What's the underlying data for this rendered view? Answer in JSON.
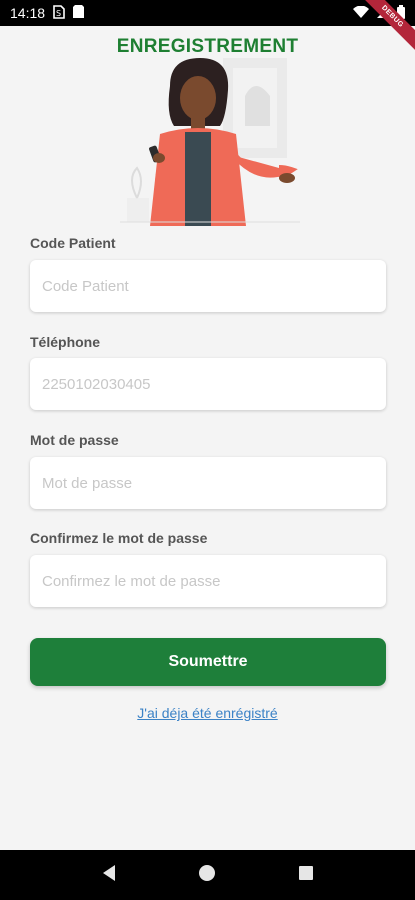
{
  "status_bar": {
    "time": "14:18"
  },
  "debug_banner": "DEBUG",
  "page": {
    "title": "ENREGISTREMENT"
  },
  "form": {
    "patient_code": {
      "label": "Code Patient",
      "placeholder": "Code Patient"
    },
    "phone": {
      "label": "Téléphone",
      "placeholder": "2250102030405"
    },
    "password": {
      "label": "Mot de passe",
      "placeholder": "Mot de passe"
    },
    "confirm_password": {
      "label": "Confirmez le mot de passe",
      "placeholder": "Confirmez le mot de passe"
    },
    "submit_label": "Soumettre",
    "login_link": "J'ai déja été enrégistré"
  },
  "colors": {
    "primary": "#1e7f3a",
    "title": "#1e7f32",
    "link": "#3b82c6",
    "background": "#f4f4f4"
  },
  "icons": [
    "sim-icon",
    "storage-icon",
    "wifi-icon",
    "signal-icon",
    "battery-icon",
    "back-icon",
    "home-icon",
    "recents-icon"
  ]
}
